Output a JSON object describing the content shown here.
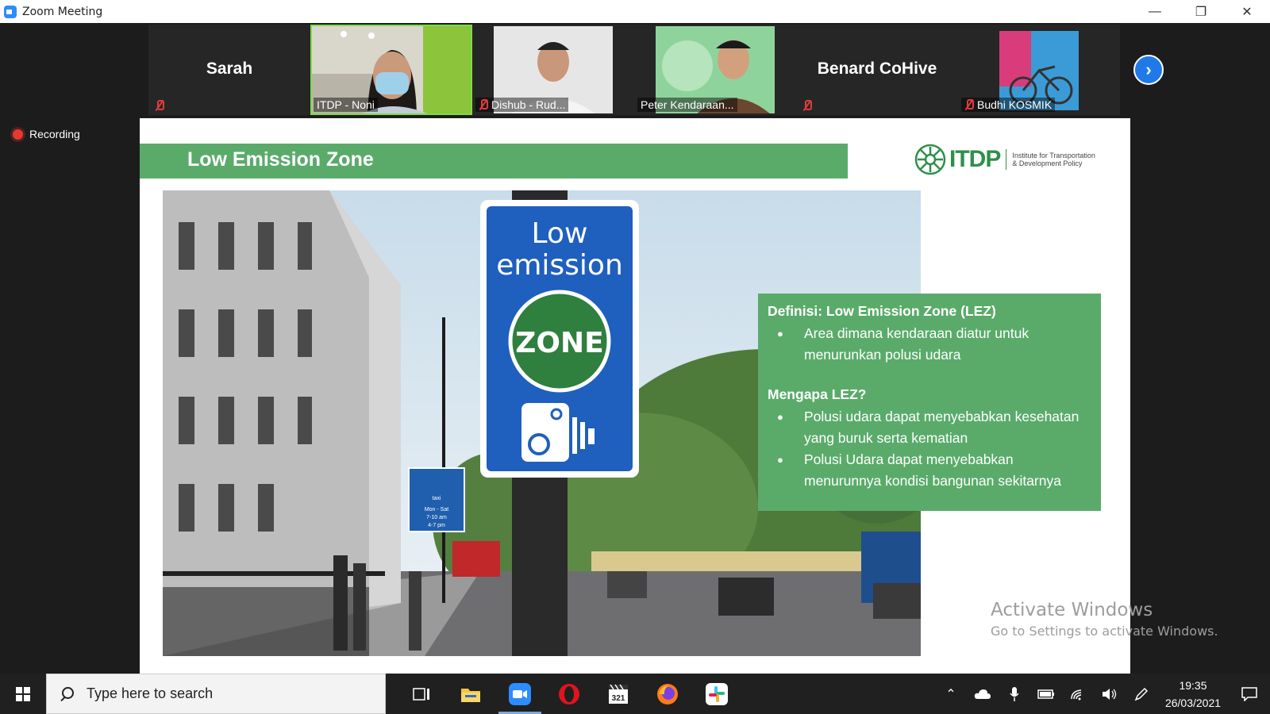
{
  "window": {
    "title": "Zoom Meeting",
    "minimize": "—",
    "maximize": "❐",
    "close": "✕"
  },
  "participants": [
    {
      "name": "Sarah",
      "type": "name",
      "muted": true
    },
    {
      "name": "ITDP - Noni",
      "type": "video",
      "muted": false,
      "active": true
    },
    {
      "name": "Dishub  - Rud...",
      "type": "video",
      "muted": true
    },
    {
      "name": "Peter Kendaraan...",
      "type": "video",
      "muted": false
    },
    {
      "name": "Benard CoHive",
      "type": "name",
      "muted": true
    },
    {
      "name": "Budhi KOSMIK",
      "type": "video",
      "muted": true
    }
  ],
  "recording": {
    "label": "Recording"
  },
  "slide": {
    "title": "Low Emission Zone",
    "logo": {
      "brand": "ITDP",
      "tagline_1": "Institute for Transportation",
      "tagline_2": "& Development Policy"
    },
    "sign": {
      "line1": "Low",
      "line2": "emission",
      "zone": "ZONE"
    },
    "bus_sign": {
      "label": "taxi",
      "days": "Mon - Sat",
      "time1": "7-10 am",
      "time2": "4-7 pm"
    },
    "info": {
      "heading1": "Definisi: Low Emission Zone (LEZ)",
      "bullets1": [
        "Area dimana kendaraan diatur untuk menurunkan polusi udara"
      ],
      "heading2": "Mengapa LEZ?",
      "bullets2": [
        "Polusi udara dapat menyebabkan kesehatan yang buruk serta kematian",
        "Polusi Udara dapat menyebabkan menurunnya kondisi bangunan sekitarnya"
      ]
    }
  },
  "watermark": {
    "line1": "Activate Windows",
    "line2": "Go to Settings to activate Windows."
  },
  "taskbar": {
    "search_placeholder": "Type here to search",
    "apps": [
      "task-view",
      "file-explorer",
      "zoom",
      "opera",
      "media-player",
      "firefox",
      "slack"
    ],
    "time": "19:35",
    "date": "26/03/2021"
  }
}
